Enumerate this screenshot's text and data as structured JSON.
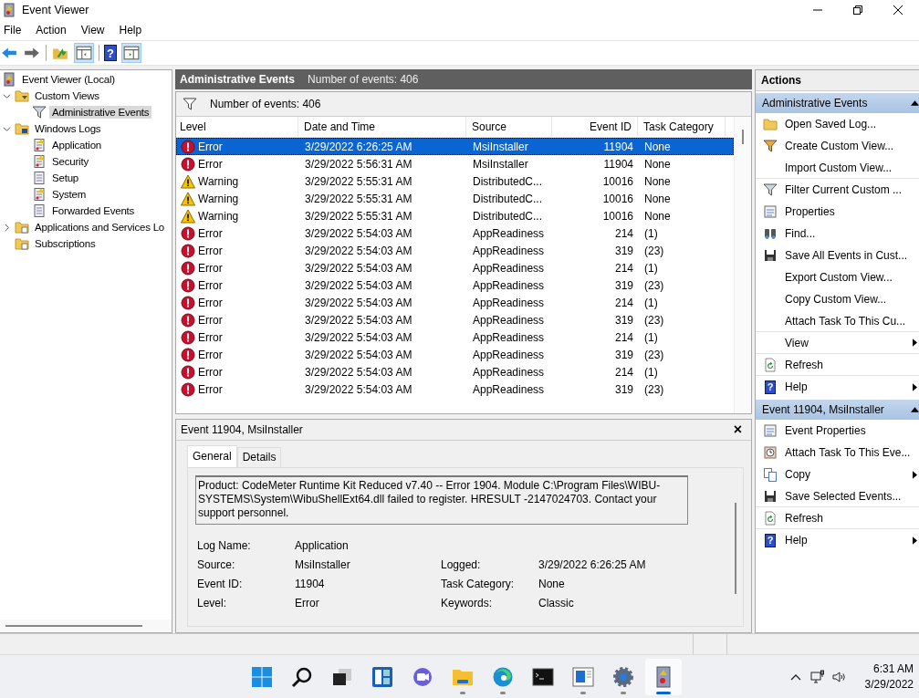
{
  "window": {
    "title": "Event Viewer"
  },
  "menu": [
    "File",
    "Action",
    "View",
    "Help"
  ],
  "toolbar": {
    "help_glyph": "?"
  },
  "tree": [
    {
      "label": "Event Viewer (Local)",
      "kind": "viewer",
      "selected": false,
      "children": [
        {
          "label": "Custom Views",
          "kind": "folder-filter",
          "selected": false,
          "expanded": true,
          "children": [
            {
              "label": "Administrative Events",
              "kind": "filter",
              "selected": true
            }
          ]
        },
        {
          "label": "Windows Logs",
          "kind": "folder-pc",
          "selected": false,
          "expanded": true,
          "children": [
            {
              "label": "Application",
              "kind": "log-warn",
              "selected": false
            },
            {
              "label": "Security",
              "kind": "log-warn",
              "selected": false
            },
            {
              "label": "Setup",
              "kind": "log",
              "selected": false
            },
            {
              "label": "System",
              "kind": "log-warn",
              "selected": false
            },
            {
              "label": "Forwarded Events",
              "kind": "log",
              "selected": false
            }
          ]
        },
        {
          "label": "Applications and Services Lo",
          "kind": "folder-log",
          "selected": false,
          "expanded": false
        },
        {
          "label": "Subscriptions",
          "kind": "folder-sub",
          "selected": false
        }
      ]
    }
  ],
  "center": {
    "title": "Administrative Events",
    "subtitle": "Number of events: 406",
    "filter_text": "Number of events: 406"
  },
  "events": {
    "columns": [
      "Level",
      "Date and Time",
      "Source",
      "Event ID",
      "Task Category"
    ],
    "rows": [
      {
        "kind": "error",
        "level": "Error",
        "date": "3/29/2022 6:26:25 AM",
        "source": "MsiInstaller",
        "id": "11904",
        "category": "None",
        "selected": true
      },
      {
        "kind": "error",
        "level": "Error",
        "date": "3/29/2022 5:56:31 AM",
        "source": "MsiInstaller",
        "id": "11904",
        "category": "None",
        "selected": false
      },
      {
        "kind": "warning",
        "level": "Warning",
        "date": "3/29/2022 5:55:31 AM",
        "source": "DistributedC...",
        "id": "10016",
        "category": "None",
        "selected": false
      },
      {
        "kind": "warning",
        "level": "Warning",
        "date": "3/29/2022 5:55:31 AM",
        "source": "DistributedC...",
        "id": "10016",
        "category": "None",
        "selected": false
      },
      {
        "kind": "warning",
        "level": "Warning",
        "date": "3/29/2022 5:55:31 AM",
        "source": "DistributedC...",
        "id": "10016",
        "category": "None",
        "selected": false
      },
      {
        "kind": "error",
        "level": "Error",
        "date": "3/29/2022 5:54:03 AM",
        "source": "AppReadiness",
        "id": "214",
        "category": "(1)",
        "selected": false
      },
      {
        "kind": "error",
        "level": "Error",
        "date": "3/29/2022 5:54:03 AM",
        "source": "AppReadiness",
        "id": "319",
        "category": "(23)",
        "selected": false
      },
      {
        "kind": "error",
        "level": "Error",
        "date": "3/29/2022 5:54:03 AM",
        "source": "AppReadiness",
        "id": "214",
        "category": "(1)",
        "selected": false
      },
      {
        "kind": "error",
        "level": "Error",
        "date": "3/29/2022 5:54:03 AM",
        "source": "AppReadiness",
        "id": "319",
        "category": "(23)",
        "selected": false
      },
      {
        "kind": "error",
        "level": "Error",
        "date": "3/29/2022 5:54:03 AM",
        "source": "AppReadiness",
        "id": "214",
        "category": "(1)",
        "selected": false
      },
      {
        "kind": "error",
        "level": "Error",
        "date": "3/29/2022 5:54:03 AM",
        "source": "AppReadiness",
        "id": "319",
        "category": "(23)",
        "selected": false
      },
      {
        "kind": "error",
        "level": "Error",
        "date": "3/29/2022 5:54:03 AM",
        "source": "AppReadiness",
        "id": "214",
        "category": "(1)",
        "selected": false
      },
      {
        "kind": "error",
        "level": "Error",
        "date": "3/29/2022 5:54:03 AM",
        "source": "AppReadiness",
        "id": "319",
        "category": "(23)",
        "selected": false
      },
      {
        "kind": "error",
        "level": "Error",
        "date": "3/29/2022 5:54:03 AM",
        "source": "AppReadiness",
        "id": "214",
        "category": "(1)",
        "selected": false
      },
      {
        "kind": "error",
        "level": "Error",
        "date": "3/29/2022 5:54:03 AM",
        "source": "AppReadiness",
        "id": "319",
        "category": "(23)",
        "selected": false
      }
    ]
  },
  "detail": {
    "title": "Event 11904, MsiInstaller",
    "close": "×",
    "tabs": [
      {
        "label": "General",
        "selected": true
      },
      {
        "label": "Details",
        "selected": false
      }
    ],
    "message": "Product: CodeMeter Runtime Kit Reduced v7.40 -- Error 1904. Module C:\\Program Files\\WIBU-SYSTEMS\\System\\WibuShellExt64.dll failed to register. HRESULT -2147024703. Contact your support personnel.",
    "fields": [
      [
        {
          "label": "Log Name:",
          "value": "Application"
        }
      ],
      [
        {
          "label": "Source:",
          "value": "MsiInstaller"
        },
        {
          "label": "Logged:",
          "value": "3/29/2022 6:26:25 AM"
        }
      ],
      [
        {
          "label": "Event ID:",
          "value": "11904"
        },
        {
          "label": "Task Category:",
          "value": "None"
        }
      ],
      [
        {
          "label": "Level:",
          "value": "Error"
        },
        {
          "label": "Keywords:",
          "value": "Classic"
        }
      ]
    ]
  },
  "actions": {
    "title": "Actions",
    "sections": [
      {
        "title": "Administrative Events",
        "items": [
          {
            "label": "Open Saved Log...",
            "kind": "open",
            "submenu": false,
            "divider_after": false
          },
          {
            "label": "Create Custom View...",
            "kind": "filter-gold",
            "submenu": false,
            "divider_after": false
          },
          {
            "label": "Import Custom View...",
            "kind": "none",
            "submenu": false,
            "divider_after": true
          },
          {
            "label": "Filter Current Custom ...",
            "kind": "filter",
            "submenu": false,
            "divider_after": false
          },
          {
            "label": "Properties",
            "kind": "props",
            "submenu": false,
            "divider_after": false
          },
          {
            "label": "Find...",
            "kind": "find",
            "submenu": false,
            "divider_after": false
          },
          {
            "label": "Save All Events in Cust...",
            "kind": "save",
            "submenu": false,
            "divider_after": false
          },
          {
            "label": "Export Custom View...",
            "kind": "none",
            "submenu": false,
            "divider_after": false
          },
          {
            "label": "Copy Custom View...",
            "kind": "none",
            "submenu": false,
            "divider_after": false
          },
          {
            "label": "Attach Task To This Cu...",
            "kind": "none",
            "submenu": false,
            "divider_after": true
          },
          {
            "label": "View",
            "kind": "none",
            "submenu": true,
            "divider_after": true
          },
          {
            "label": "Refresh",
            "kind": "refresh",
            "submenu": false,
            "divider_after": true
          },
          {
            "label": "Help",
            "kind": "help",
            "glyph": "?",
            "submenu": true,
            "divider_after": false
          }
        ]
      },
      {
        "title": "Event 11904, MsiInstaller",
        "items": [
          {
            "label": "Event Properties",
            "kind": "props",
            "submenu": false,
            "divider_after": false
          },
          {
            "label": "Attach Task To This Eve...",
            "kind": "task",
            "submenu": false,
            "divider_after": false
          },
          {
            "label": "Copy",
            "kind": "copy",
            "submenu": true,
            "divider_after": false
          },
          {
            "label": "Save Selected Events...",
            "kind": "save",
            "submenu": false,
            "divider_after": true
          },
          {
            "label": "Refresh",
            "kind": "refresh",
            "submenu": false,
            "divider_after": true
          },
          {
            "label": "Help",
            "kind": "help",
            "glyph": "?",
            "submenu": true,
            "divider_after": false
          }
        ]
      }
    ]
  },
  "taskbar": {
    "apps": [
      {
        "kind": "start",
        "running": false,
        "selected": false
      },
      {
        "kind": "search",
        "running": false,
        "selected": false
      },
      {
        "kind": "taskview",
        "running": false,
        "selected": false
      },
      {
        "kind": "widgets",
        "running": false,
        "selected": false
      },
      {
        "kind": "chat",
        "running": false,
        "selected": false
      },
      {
        "kind": "explorer",
        "running": true,
        "selected": false
      },
      {
        "kind": "edge",
        "running": true,
        "selected": false
      },
      {
        "kind": "terminal",
        "running": false,
        "selected": false
      },
      {
        "kind": "window",
        "running": true,
        "selected": false
      },
      {
        "kind": "settings",
        "running": true,
        "selected": false
      },
      {
        "kind": "eventviewer",
        "running": true,
        "selected": true
      }
    ],
    "time": "6:31 AM",
    "date": "3/29/2022"
  }
}
